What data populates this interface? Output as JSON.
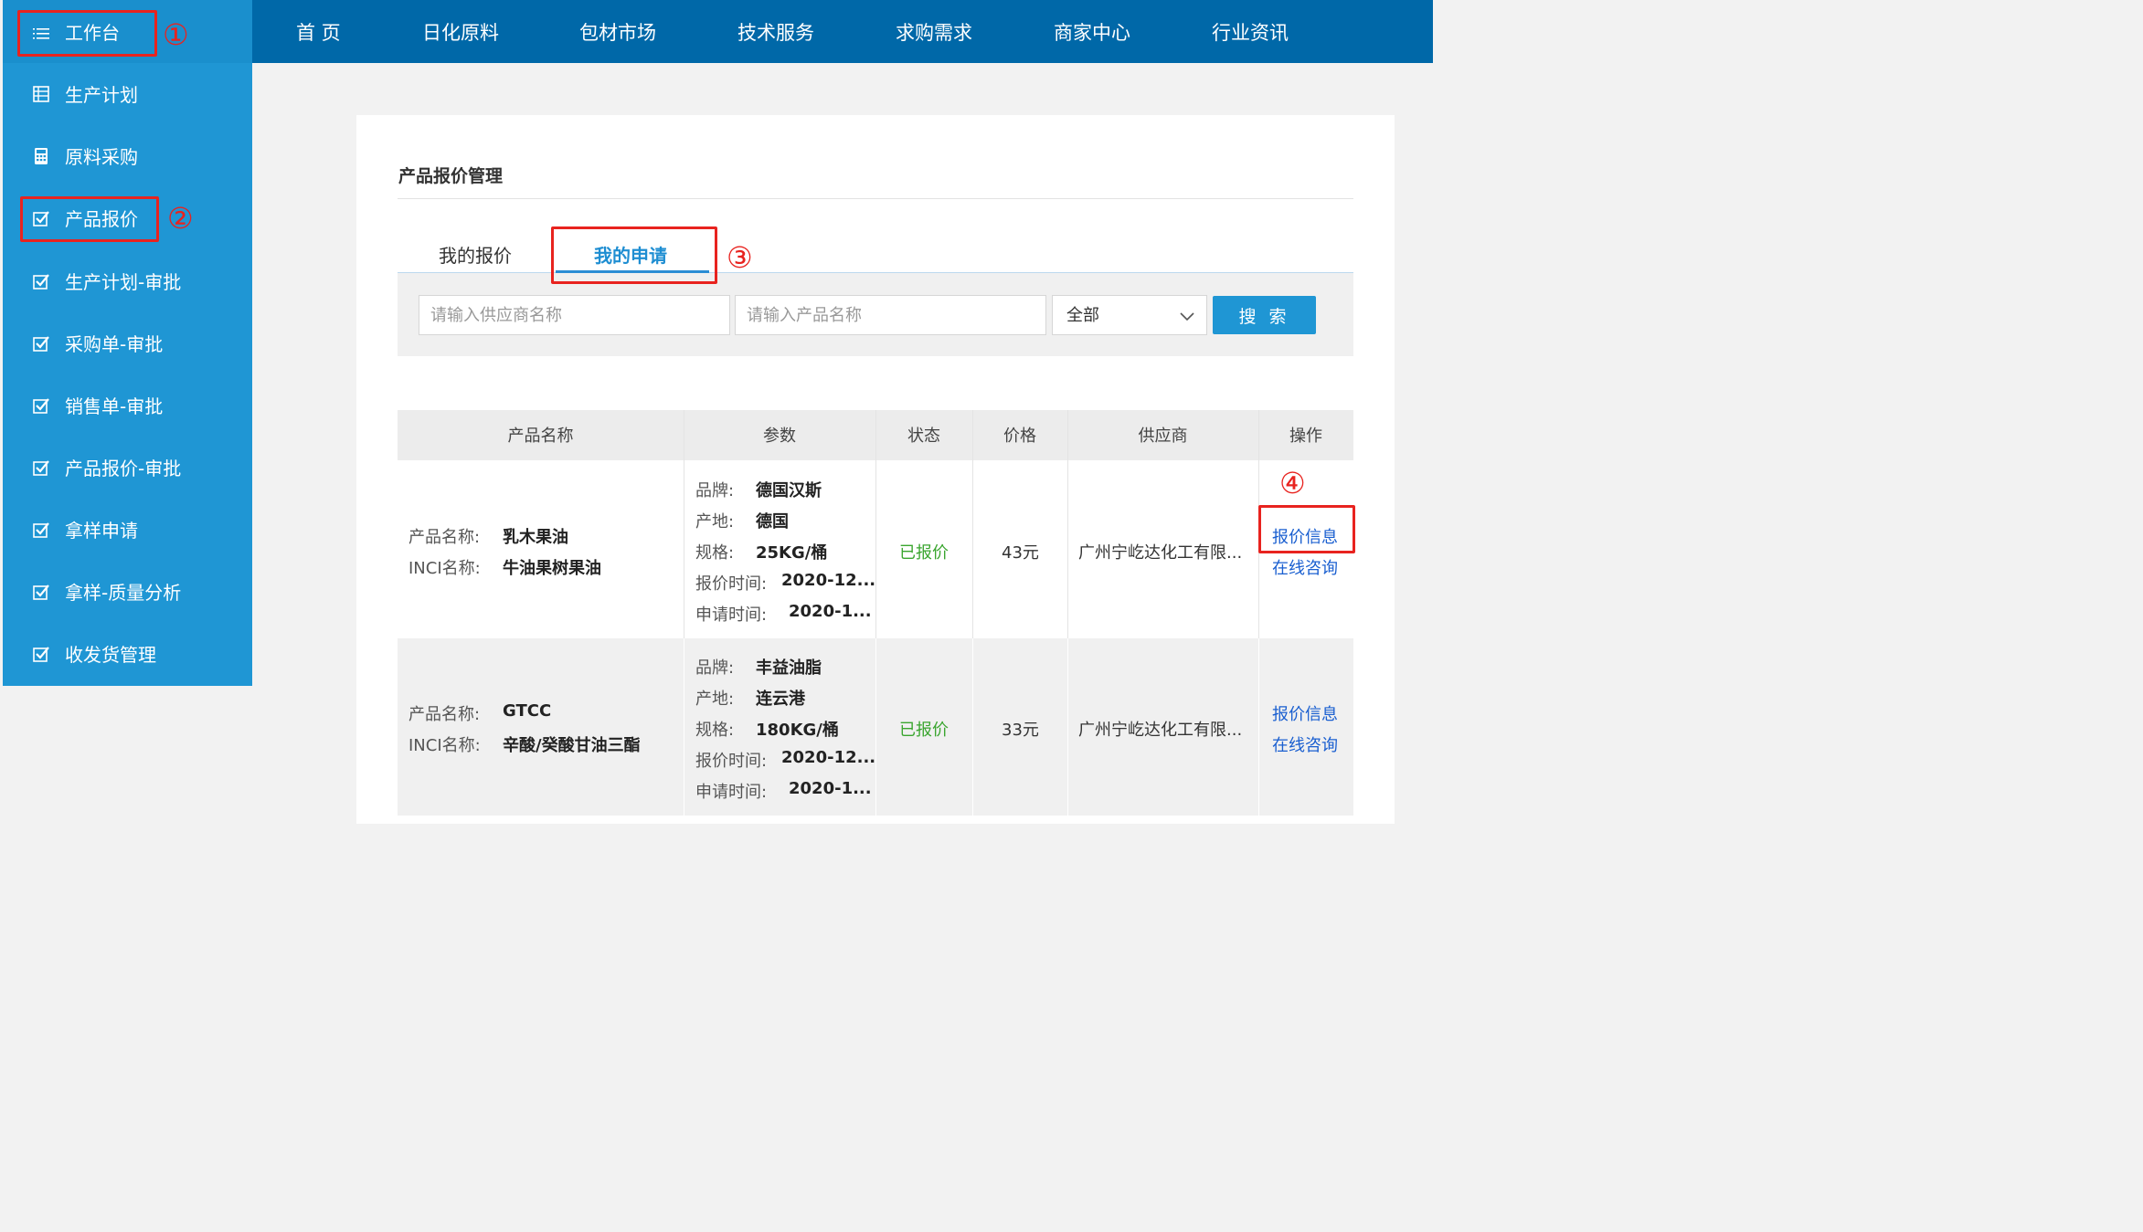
{
  "topnav": {
    "items": [
      {
        "label": "首 页"
      },
      {
        "label": "日化原料"
      },
      {
        "label": "包材市场"
      },
      {
        "label": "技术服务"
      },
      {
        "label": "求购需求"
      },
      {
        "label": "商家中心"
      },
      {
        "label": "行业资讯"
      }
    ]
  },
  "sidebar": {
    "header": {
      "label": "工作台",
      "icon": "list-icon"
    },
    "items": [
      {
        "label": "生产计划",
        "icon": "table-icon"
      },
      {
        "label": "原料采购",
        "icon": "calculator-icon"
      },
      {
        "label": "产品报价",
        "icon": "check-icon"
      },
      {
        "label": "生产计划-审批",
        "icon": "check-icon"
      },
      {
        "label": "采购单-审批",
        "icon": "check-icon"
      },
      {
        "label": "销售单-审批",
        "icon": "check-icon"
      },
      {
        "label": "产品报价-审批",
        "icon": "check-icon"
      },
      {
        "label": "拿样申请",
        "icon": "check-icon"
      },
      {
        "label": "拿样-质量分析",
        "icon": "check-icon"
      },
      {
        "label": "收发货管理",
        "icon": "check-icon"
      }
    ]
  },
  "main": {
    "title": "产品报价管理",
    "tabs": [
      {
        "label": "我的报价",
        "active": false
      },
      {
        "label": "我的申请",
        "active": true
      }
    ],
    "search": {
      "supplier_placeholder": "请输入供应商名称",
      "product_placeholder": "请输入产品名称",
      "status_value": "全部",
      "button_label": "搜 索"
    },
    "table": {
      "headers": [
        "产品名称",
        "参数",
        "状态",
        "价格",
        "供应商",
        "操作"
      ],
      "field_labels": {
        "product_name": "产品名称:",
        "inci_name": "INCI名称:",
        "brand": "品牌:",
        "origin": "产地:",
        "spec": "规格:",
        "quote_time": "报价时间:",
        "apply_time": "申请时间:"
      },
      "rows": [
        {
          "product_name": "乳木果油",
          "inci_name": "牛油果树果油",
          "brand": "德国汉斯",
          "origin": "德国",
          "spec": "25KG/桶",
          "quote_time": "2020-12...",
          "apply_time": "2020-1...",
          "status": "已报价",
          "price": "43元",
          "supplier": "广州宁屹达化工有限...",
          "action_quote": "报价信息",
          "action_consult": "在线咨询"
        },
        {
          "product_name": "GTCC",
          "inci_name": "辛酸/癸酸甘油三酯",
          "brand": "丰益油脂",
          "origin": "连云港",
          "spec": "180KG/桶",
          "quote_time": "2020-12...",
          "apply_time": "2020-1...",
          "status": "已报价",
          "price": "33元",
          "supplier": "广州宁屹达化工有限...",
          "action_quote": "报价信息",
          "action_consult": "在线咨询"
        }
      ]
    }
  },
  "annotations": {
    "markers": [
      "①",
      "②",
      "③",
      "④"
    ],
    "color": "#e8231f"
  },
  "colors": {
    "topbar": "#0068a8",
    "sidebar": "#1f96d4",
    "accent": "#2a8dd4",
    "status_green": "#3aa52f",
    "link_blue": "#1a5fd0"
  }
}
